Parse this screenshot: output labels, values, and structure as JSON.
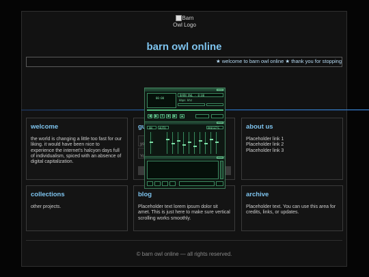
{
  "header": {
    "logo_alt": "Barn Owl Logo",
    "site_title": "barn owl online",
    "marquee_text": "★ welcome to barn owl online ★ thank you for stopping"
  },
  "cards": {
    "welcome": {
      "title": "welcome",
      "body": "the world is changing a little too fast for our liking. it would have been nice to experience the internet's halcyon days full of individualism, spiced with an absence of digital capitalization."
    },
    "guestbook": {
      "title": "gu",
      "field1_placeholder": "yo",
      "field2_placeholder": "Yo"
    },
    "about": {
      "title": "about us",
      "links": [
        "Placeholder link 1",
        "Placeholder link 2",
        "Placeholder link 3"
      ]
    },
    "collections": {
      "title": "collections",
      "body": "other projects."
    },
    "blog": {
      "title": "blog",
      "body": "Placeholder text lorem ipsum dolor sit amet. This is just here to make sure vertical scrolling works smoothly."
    },
    "archive": {
      "title": "archive",
      "body": "Placeholder text. You can use this area for credits, links, or updates."
    }
  },
  "player": {
    "accent_color": "#52c283",
    "frame_color": "#3f7d5a",
    "track_text": "BARN OWL - 0:00",
    "time_display": "00:00",
    "kbps_label": "kbps",
    "khz_label": "khz",
    "eq_preset_label": "PRESETS",
    "eq_on_label": "ON",
    "eq_auto_label": "AUTO",
    "buttons": [
      "prev-icon",
      "play-icon",
      "pause-icon",
      "stop-icon",
      "next-icon",
      "eject-icon"
    ]
  },
  "footer": {
    "text": "© barn owl online — all rights reserved."
  }
}
